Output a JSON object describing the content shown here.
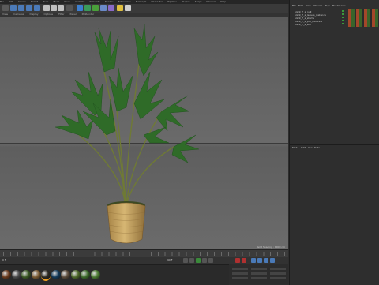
{
  "menubar": {
    "items": [
      "File",
      "Edit",
      "Create",
      "Select",
      "Tools",
      "Mesh",
      "Snap",
      "Animate",
      "Simulate",
      "Render",
      "Extensions",
      "MoGraph",
      "Character",
      "Pipeline",
      "Plugins",
      "Script",
      "Window",
      "Help"
    ]
  },
  "viewport": {
    "menu": [
      "View",
      "Cameras",
      "Display",
      "Options",
      "Filter",
      "Panel",
      "ProRender"
    ],
    "status": "Grid Spacing : 1000 cm"
  },
  "object_manager": {
    "menu": [
      "File",
      "Edit",
      "View",
      "Objects",
      "Tags",
      "Bookmarks"
    ],
    "objects": [
      "plant_7_a_null",
      "plant_7_a_leaves_instance",
      "plant_7_a_stems",
      "plant_7_a_pot_instance",
      "plant_7_a_soil"
    ]
  },
  "attribute_manager": {
    "menu": [
      "Mode",
      "Edit",
      "User Data"
    ]
  },
  "timeline": {
    "start": "0 F",
    "end": "90 F"
  },
  "materials": {
    "swatches": [
      "#6a3a1c",
      "#4a4a4a",
      "#3c5a25",
      "#7a5a32",
      "#2d2a22",
      "#123a5a",
      "#5a4a3a",
      "#4e6a2a",
      "#3c6a2a",
      "#4a7a30"
    ]
  },
  "colors": {
    "accent": "#f0a020",
    "leaf": "#2e6a2a",
    "pot": "#c8a462"
  }
}
